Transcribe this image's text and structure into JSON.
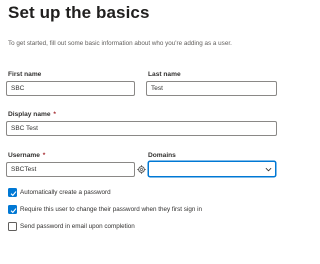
{
  "header": {
    "title": "Set up the basics",
    "intro": "To get started, fill out some basic information about who you're adding as a user."
  },
  "form": {
    "first_name": {
      "label": "First name",
      "value": "SBC"
    },
    "last_name": {
      "label": "Last name",
      "value": "Test"
    },
    "display_name": {
      "label": "Display name",
      "required_marker": "*",
      "value": "SBC Test"
    },
    "username": {
      "label": "Username",
      "required_marker": "*",
      "value": "SBCTest"
    },
    "domains": {
      "label": "Domains",
      "value": ""
    }
  },
  "options": [
    {
      "label": "Automatically create a password",
      "checked": true
    },
    {
      "label": "Require this user to change their password when they first sign in",
      "checked": true
    },
    {
      "label": "Send password in email upon completion",
      "checked": false
    }
  ],
  "colors": {
    "accent": "#0078d4",
    "required": "#a4262c",
    "border": "#8a8886"
  },
  "icons": {
    "username_help": "gear-icon",
    "domains_dropdown": "chevron-down-icon",
    "checkbox_checked": "checkmark-icon"
  }
}
